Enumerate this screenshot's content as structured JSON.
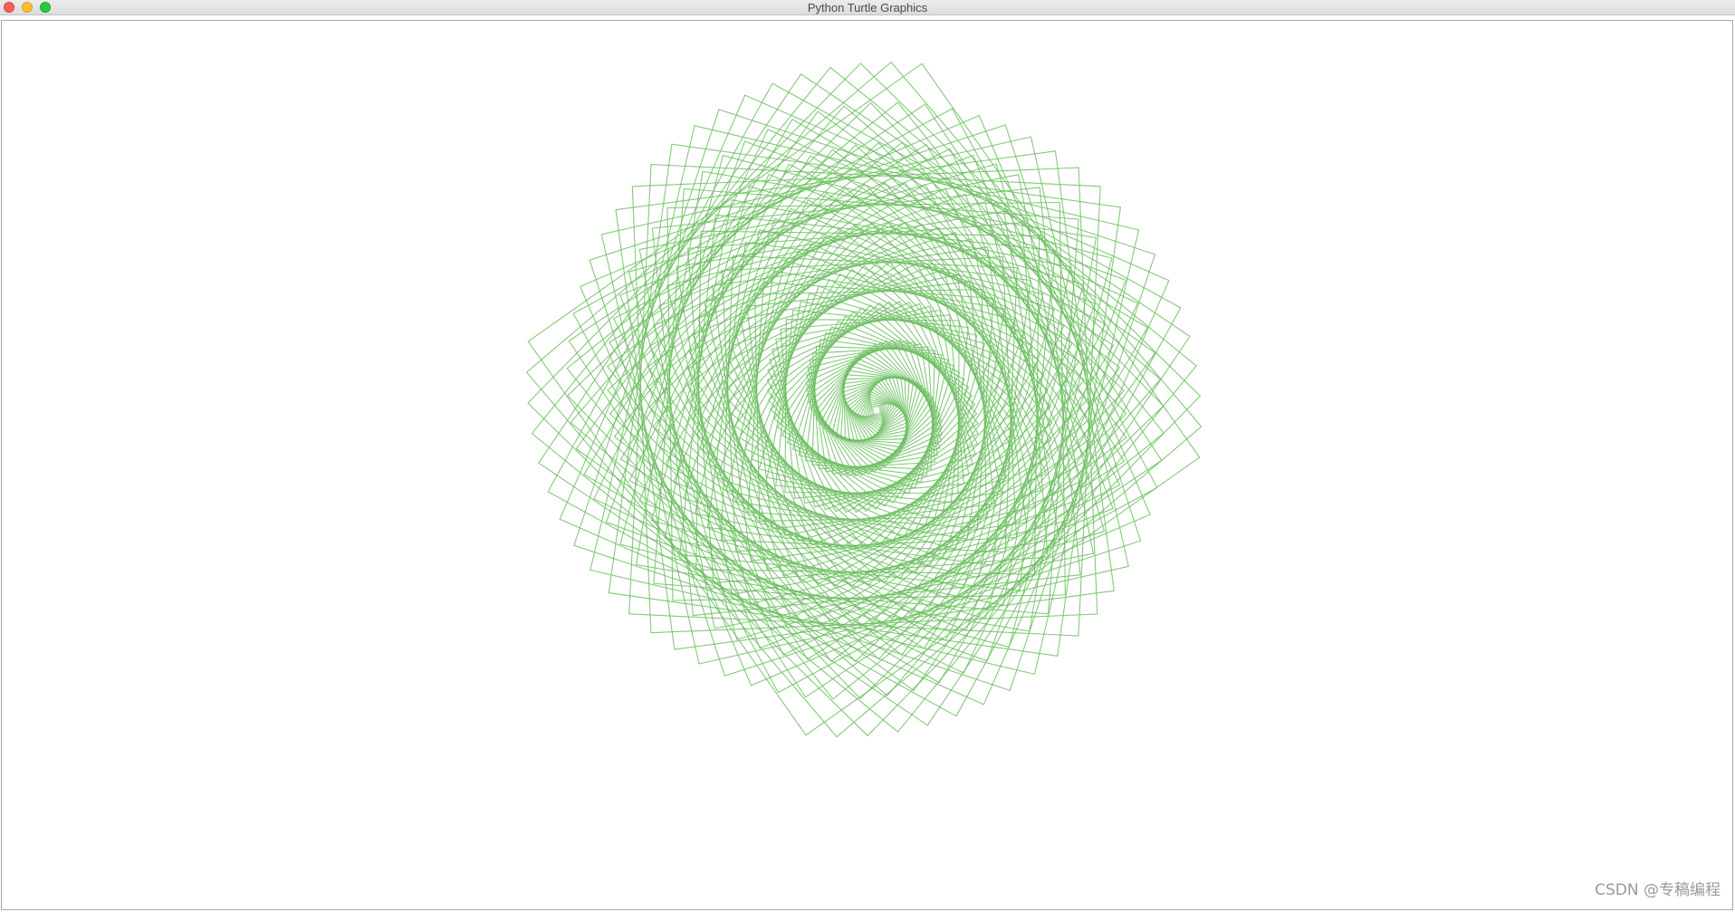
{
  "window": {
    "title": "Python Turtle Graphics",
    "buttons": {
      "close": "close-button",
      "minimize": "minimize-button",
      "zoom": "zoom-button"
    }
  },
  "drawing": {
    "pen_color": "#6fbf63",
    "background": "#ffffff",
    "shape": "square",
    "pattern": "rotating-square-spiral"
  },
  "watermark": {
    "text": "CSDN @专稿编程"
  }
}
